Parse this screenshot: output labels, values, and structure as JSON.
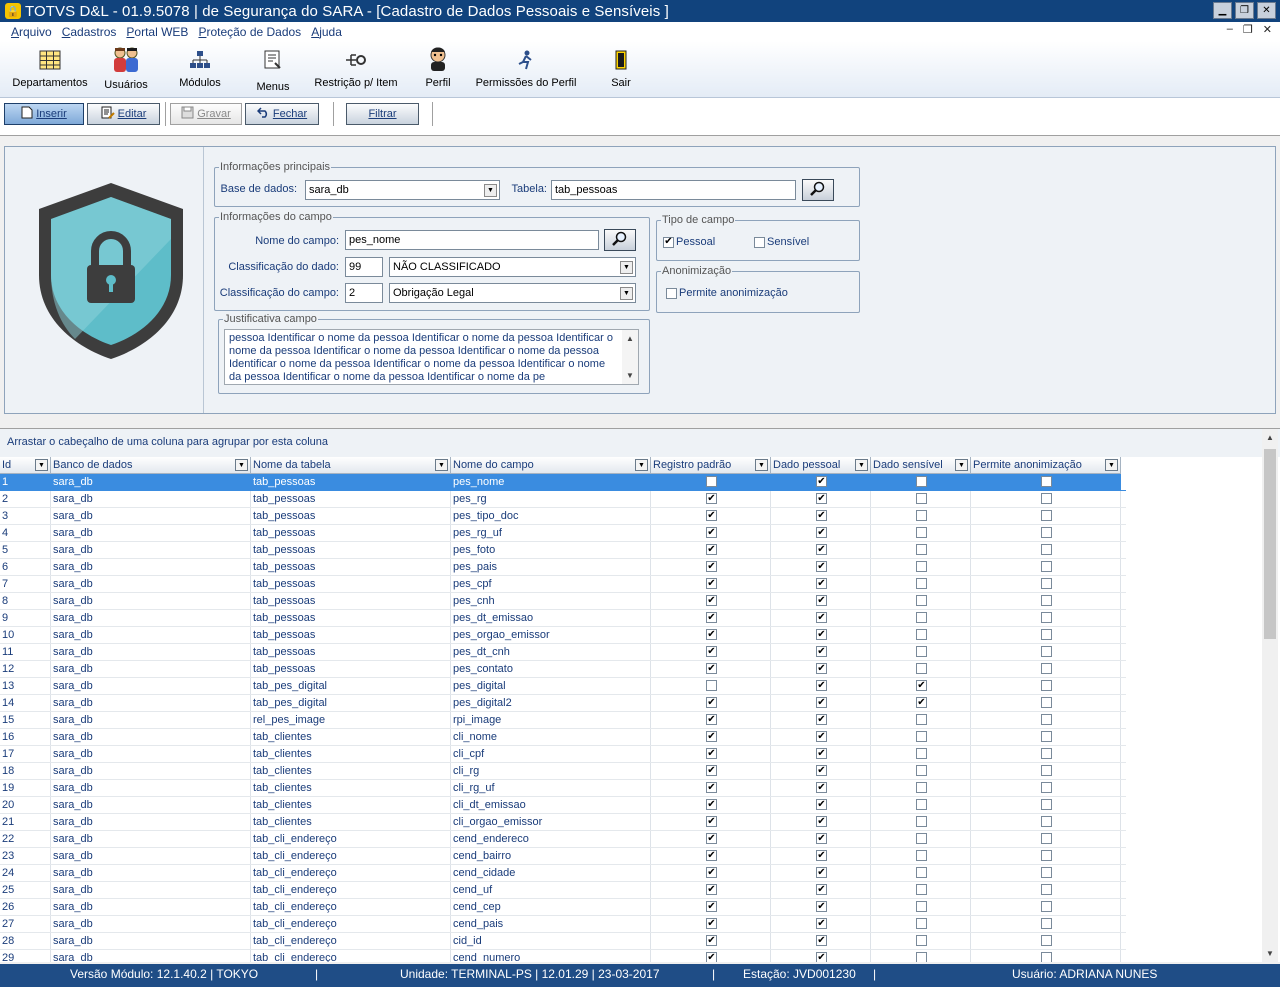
{
  "window": {
    "title": "TOTVS D&L - 01.9.5078 | de Segurança do SARA - [Cadastro de Dados Pessoais e Sensíveis ]",
    "minimize_glyph": "▁",
    "restore_glyph": "❐",
    "close_glyph": "✕"
  },
  "menu": {
    "items": [
      {
        "underline": "A",
        "rest": "rquivo"
      },
      {
        "underline": "C",
        "rest": "adastros"
      },
      {
        "underline": "P",
        "rest": "ortal WEB"
      },
      {
        "underline": "P",
        "rest": "roteção de Dados"
      },
      {
        "underline": "A",
        "rest": "juda"
      }
    ],
    "mdi_min": "–",
    "mdi_restore": "❐",
    "mdi_close": "✕"
  },
  "toolbar": {
    "departamentos": "Departamentos",
    "usuarios": "Usuários",
    "modulos": "Módulos",
    "menus": "Menus",
    "restricao": "Restrição p/ Item",
    "perfil": "Perfil",
    "permissoes": "Permissões do Perfil",
    "sair": "Sair"
  },
  "actions": {
    "inserir": "Inserir",
    "editar": "Editar",
    "gravar": "Gravar",
    "fechar": "Fechar",
    "filtrar": "Filtrar"
  },
  "form": {
    "principais_legend": "Informações principais",
    "base_label": "Base de dados:",
    "base_value": "sara_db",
    "tabela_label": "Tabela:",
    "tabela_value": "tab_pessoas",
    "campo_legend": "Informações do campo",
    "nome_campo_label": "Nome do campo:",
    "nome_campo_value": "pes_nome",
    "class_dado_label": "Classificação do dado:",
    "class_dado_code": "99",
    "class_dado_value": "NÃO CLASSIFICADO",
    "class_campo_label": "Classificação do campo:",
    "class_campo_code": "2",
    "class_campo_value": "Obrigação Legal",
    "tipo_legend": "Tipo de campo",
    "pessoal_label": "Pessoal",
    "pessoal_checked": true,
    "sensivel_label": "Sensível",
    "sensivel_checked": false,
    "anon_legend": "Anonimização",
    "anon_label": "Permite anonimização",
    "anon_checked": false,
    "justificativa_legend": "Justificativa campo",
    "justificativa_text": "pessoa Identificar o nome da pessoa Identificar o nome da pessoa Identificar o nome da pessoa Identificar o nome da pessoa Identificar o nome da pessoa Identificar o nome da pessoa Identificar o nome da pessoa Identificar o nome da pessoa Identificar o nome da pessoa Identificar o nome da pe"
  },
  "grid": {
    "group_hint": "Arrastar o cabeçalho de uma coluna para agrupar por esta coluna",
    "columns": [
      "Id",
      "Banco de dados",
      "Nome da tabela",
      "Nome do campo",
      "Registro padrão",
      "Dado pessoal",
      "Dado sensível",
      "Permite anonimização"
    ],
    "selected_row": 0,
    "rows": [
      [
        "1",
        "sara_db",
        "tab_pessoas",
        "pes_nome",
        false,
        true,
        false,
        false
      ],
      [
        "2",
        "sara_db",
        "tab_pessoas",
        "pes_rg",
        true,
        true,
        false,
        false
      ],
      [
        "3",
        "sara_db",
        "tab_pessoas",
        "pes_tipo_doc",
        true,
        true,
        false,
        false
      ],
      [
        "4",
        "sara_db",
        "tab_pessoas",
        "pes_rg_uf",
        true,
        true,
        false,
        false
      ],
      [
        "5",
        "sara_db",
        "tab_pessoas",
        "pes_foto",
        true,
        true,
        false,
        false
      ],
      [
        "6",
        "sara_db",
        "tab_pessoas",
        "pes_pais",
        true,
        true,
        false,
        false
      ],
      [
        "7",
        "sara_db",
        "tab_pessoas",
        "pes_cpf",
        true,
        true,
        false,
        false
      ],
      [
        "8",
        "sara_db",
        "tab_pessoas",
        "pes_cnh",
        true,
        true,
        false,
        false
      ],
      [
        "9",
        "sara_db",
        "tab_pessoas",
        "pes_dt_emissao",
        true,
        true,
        false,
        false
      ],
      [
        "10",
        "sara_db",
        "tab_pessoas",
        "pes_orgao_emissor",
        true,
        true,
        false,
        false
      ],
      [
        "11",
        "sara_db",
        "tab_pessoas",
        "pes_dt_cnh",
        true,
        true,
        false,
        false
      ],
      [
        "12",
        "sara_db",
        "tab_pessoas",
        "pes_contato",
        true,
        true,
        false,
        false
      ],
      [
        "13",
        "sara_db",
        "tab_pes_digital",
        "pes_digital",
        false,
        true,
        true,
        false
      ],
      [
        "14",
        "sara_db",
        "tab_pes_digital",
        "pes_digital2",
        true,
        true,
        true,
        false
      ],
      [
        "15",
        "sara_db",
        "rel_pes_image",
        "rpi_image",
        true,
        true,
        false,
        false
      ],
      [
        "16",
        "sara_db",
        "tab_clientes",
        "cli_nome",
        true,
        true,
        false,
        false
      ],
      [
        "17",
        "sara_db",
        "tab_clientes",
        "cli_cpf",
        true,
        true,
        false,
        false
      ],
      [
        "18",
        "sara_db",
        "tab_clientes",
        "cli_rg",
        true,
        true,
        false,
        false
      ],
      [
        "19",
        "sara_db",
        "tab_clientes",
        "cli_rg_uf",
        true,
        true,
        false,
        false
      ],
      [
        "20",
        "sara_db",
        "tab_clientes",
        "cli_dt_emissao",
        true,
        true,
        false,
        false
      ],
      [
        "21",
        "sara_db",
        "tab_clientes",
        "cli_orgao_emissor",
        true,
        true,
        false,
        false
      ],
      [
        "22",
        "sara_db",
        "tab_cli_endereço",
        "cend_endereco",
        true,
        true,
        false,
        false
      ],
      [
        "23",
        "sara_db",
        "tab_cli_endereço",
        "cend_bairro",
        true,
        true,
        false,
        false
      ],
      [
        "24",
        "sara_db",
        "tab_cli_endereço",
        "cend_cidade",
        true,
        true,
        false,
        false
      ],
      [
        "25",
        "sara_db",
        "tab_cli_endereço",
        "cend_uf",
        true,
        true,
        false,
        false
      ],
      [
        "26",
        "sara_db",
        "tab_cli_endereço",
        "cend_cep",
        true,
        true,
        false,
        false
      ],
      [
        "27",
        "sara_db",
        "tab_cli_endereço",
        "cend_pais",
        true,
        true,
        false,
        false
      ],
      [
        "28",
        "sara_db",
        "tab_cli_endereço",
        "cid_id",
        true,
        true,
        false,
        false
      ],
      [
        "29",
        "sara_db",
        "tab_cli_endereço",
        "cend_numero",
        true,
        true,
        false,
        false
      ]
    ]
  },
  "status": {
    "versao": "Versão Módulo:  12.1.40.2  |  TOKYO",
    "unidade": "Unidade:  TERMINAL-PS | 12.01.29 | 23-03-2017",
    "estacao": "Estação:  JVD001230",
    "usuario": "Usuário: ADRIANA NUNES"
  },
  "colors": {
    "titlebar": "#11437d",
    "statusbar": "#1f4d86",
    "selection": "#3a8ce0",
    "shield_outer": "#3d3d3d",
    "shield_inner": "#5ebdc9"
  }
}
